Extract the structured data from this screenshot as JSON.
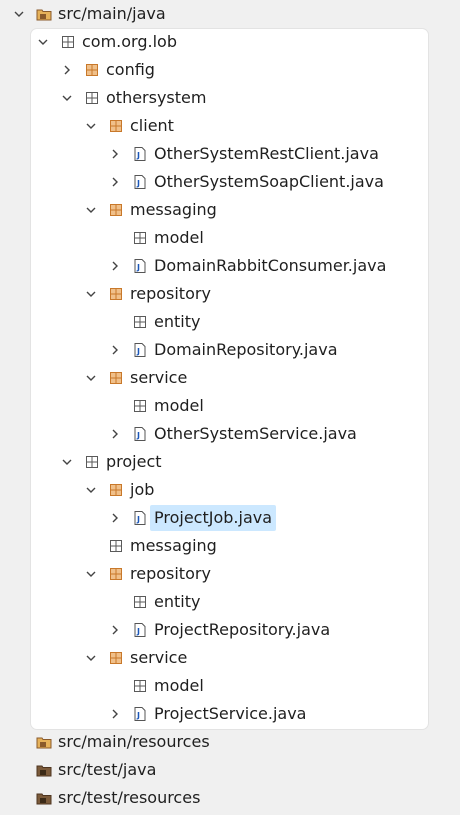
{
  "tree": {
    "top_folder": "src/main/java",
    "bottom_folders": [
      "src/main/resources",
      "src/test/java",
      "src/test/resources"
    ],
    "nodes": [
      {
        "label": "com.org.lob",
        "type": "package-empty",
        "expanded": true
      },
      {
        "label": "config",
        "type": "package",
        "expanded": false
      },
      {
        "label": "othersystem",
        "type": "package-empty",
        "expanded": true
      },
      {
        "label": "client",
        "type": "package",
        "expanded": true
      },
      {
        "label": "OtherSystemRestClient.java",
        "type": "java",
        "expanded": false
      },
      {
        "label": "OtherSystemSoapClient.java",
        "type": "java",
        "expanded": false
      },
      {
        "label": "messaging",
        "type": "package",
        "expanded": true
      },
      {
        "label": "model",
        "type": "package-empty"
      },
      {
        "label": "DomainRabbitConsumer.java",
        "type": "java",
        "expanded": false
      },
      {
        "label": "repository",
        "type": "package",
        "expanded": true
      },
      {
        "label": "entity",
        "type": "package-empty"
      },
      {
        "label": "DomainRepository.java",
        "type": "java",
        "expanded": false
      },
      {
        "label": "service",
        "type": "package",
        "expanded": true
      },
      {
        "label": "model",
        "type": "package-empty"
      },
      {
        "label": "OtherSystemService.java",
        "type": "java",
        "expanded": false
      },
      {
        "label": "project",
        "type": "package-empty",
        "expanded": true
      },
      {
        "label": "job",
        "type": "package",
        "expanded": true
      },
      {
        "label": "ProjectJob.java",
        "type": "java",
        "expanded": false,
        "selected": true
      },
      {
        "label": "messaging",
        "type": "package-empty"
      },
      {
        "label": "repository",
        "type": "package",
        "expanded": true
      },
      {
        "label": "entity",
        "type": "package-empty"
      },
      {
        "label": "ProjectRepository.java",
        "type": "java",
        "expanded": false
      },
      {
        "label": "service",
        "type": "package",
        "expanded": true
      },
      {
        "label": "model",
        "type": "package-empty"
      },
      {
        "label": "ProjectService.java",
        "type": "java",
        "expanded": false
      }
    ]
  },
  "colors": {
    "selection": "#cce8ff",
    "package": "#c8782a",
    "source_folder": "#8a5a2b"
  }
}
